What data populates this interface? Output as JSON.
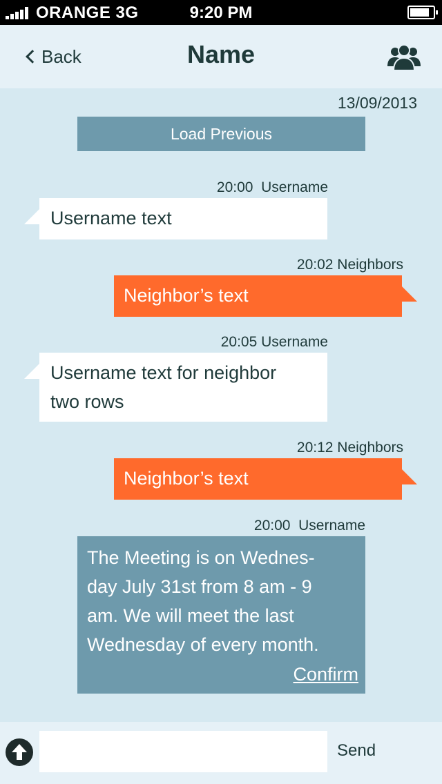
{
  "status_bar": {
    "carrier": "ORANGE  3G",
    "time": "9:20 PM",
    "battery_level": 0.85
  },
  "nav": {
    "back_label": "Back",
    "title": "Name",
    "group_icon": "group-icon"
  },
  "chat": {
    "date": "13/09/2013",
    "load_previous": "Load Previous",
    "messages": [
      {
        "direction": "in",
        "meta": "20:00  Username",
        "text": "Username text"
      },
      {
        "direction": "out",
        "meta": "20:02 Neighbors",
        "text": "Neighbor’s text"
      },
      {
        "direction": "in",
        "meta": "20:05 Username",
        "text_lines": [
          "Username text for neighbor",
          "two rows"
        ]
      },
      {
        "direction": "out",
        "meta": "20:12 Neighbors",
        "text": "Neighbor’s text"
      }
    ],
    "notice": {
      "meta": "20:00  Username",
      "lines": [
        "The  Meeting is on Wednes-",
        "day July 31st from 8 am - 9",
        "am. We will meet the last",
        "Wednesday of every month."
      ],
      "confirm_label": "Confirm"
    }
  },
  "composer": {
    "input_value": "",
    "send_label": "Send",
    "attach_icon": "upload-arrow-icon"
  },
  "colors": {
    "background": "#d6e9f1",
    "bar": "#e6f1f7",
    "incoming": "#ffffff",
    "outgoing": "#ff6a2c",
    "notice": "#6e9aac",
    "text": "#1f3a3a"
  }
}
